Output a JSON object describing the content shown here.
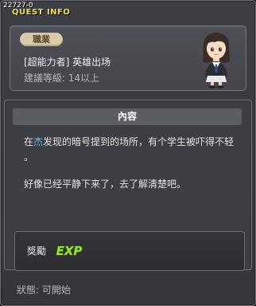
{
  "window": {
    "quest_id": "22727-0",
    "title": "QUEST INFO"
  },
  "info": {
    "job_badge": "職業",
    "quest_name": "[超能力者] 英雄出场",
    "recommended_level": "建議等級: 14以上",
    "npc_portrait_icon": "npc-girl-portrait"
  },
  "content": {
    "header": "內容",
    "line1_pre": "在",
    "line1_highlight": "杰",
    "line1_post": "发现的暗号提到的场所，有个学生被吓得不轻",
    "line2": "。",
    "line3": "好像已经平静下来了，去了解清楚吧。"
  },
  "reward": {
    "label": "獎勵",
    "exp_icon_text": "EXP"
  },
  "status": "狀態: 可開始",
  "colors": {
    "title_yellow": "#f2e14d",
    "highlight_blue": "#63c0ea",
    "exp_green": "#9be22c"
  }
}
